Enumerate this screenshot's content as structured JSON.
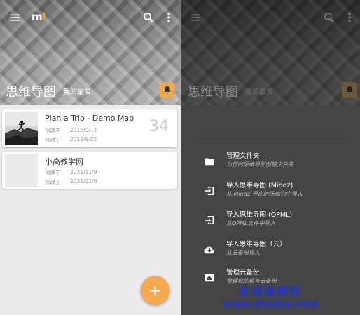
{
  "left": {
    "logo": "m",
    "logo_bang": "!",
    "title": "思维导图",
    "favorites_label": "我的最爱",
    "maps": [
      {
        "title": "Plan a Trip - Demo Map",
        "created_label": "创建于",
        "created": "2019/9/11",
        "modified_label": "修改于",
        "modified": "2019/9/22",
        "count": "34"
      },
      {
        "title": "小高教学网",
        "created_label": "创建于",
        "created": "2021/11/9",
        "modified_label": "修改于",
        "modified": "2021/11/9"
      }
    ],
    "fab_label": "+"
  },
  "right": {
    "title": "思维导图",
    "favorites_label": "我的最爱",
    "menu": [
      {
        "icon": "folder-icon",
        "label": "管理文件夹",
        "sub": "为您的思维导图创建文件夹"
      },
      {
        "icon": "import-icon",
        "label": "导入思维导图 (Mindz)",
        "sub": "从 Mindz-导出的压缩包中导入"
      },
      {
        "icon": "import-icon",
        "label": "导入思维导图 (OPML)",
        "sub": "从OPML文件中导入"
      },
      {
        "icon": "cloud-download-icon",
        "label": "导入思维导图（云）",
        "sub": "从云备份导入"
      },
      {
        "icon": "cloud-backup-icon",
        "label": "管理云备份",
        "sub": "管理您的现有云备份"
      }
    ]
  },
  "watermark": {
    "line1": "其他破解网",
    "line2": "www.qtpojie.com"
  },
  "colors": {
    "accent": "#f5a94c",
    "watermark": "#1f33cf",
    "drawer": "#454545"
  }
}
